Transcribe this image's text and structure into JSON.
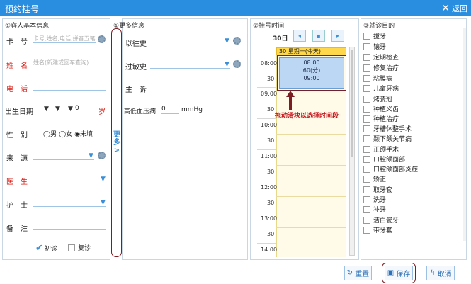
{
  "window": {
    "title": "预约挂号",
    "close_label": "返回"
  },
  "basic": {
    "title": "①客人基本信息",
    "card_label": "卡　号",
    "card_placeholder": "卡号,姓名,电话,拼音五笔",
    "name_label": "姓　名",
    "name_placeholder": "姓名(新建或回车查询)",
    "phone_label": "电　话",
    "birth_label": "出生日期",
    "birth_value": "0",
    "birth_unit": "岁",
    "gender_label": "性　别",
    "gender_options": [
      "男",
      "女",
      "未填"
    ],
    "gender_selected": "未填",
    "source_label": "来　源",
    "doctor_label": "医　生",
    "nurse_label": "护　士",
    "note_label": "备　注",
    "first_visit": "初诊",
    "revisit": "复诊"
  },
  "more": {
    "title": "①更多信息",
    "past_label": "以往史",
    "allergy_label": "过敏史",
    "complaint_label": "主　诉",
    "bp_label": "高低血压病",
    "bp_value": "0",
    "bp_unit": "mmHg",
    "toggle_label": "更多>"
  },
  "schedule": {
    "title": "②挂号时间",
    "day": "30日",
    "day_header": "30 星期一(今天)",
    "times": [
      "08:00",
      "30",
      "09:00",
      "30",
      "10:00",
      "30",
      "11:00",
      "30",
      "12:00",
      "30",
      "13:00",
      "30",
      "14:00"
    ],
    "slot_start": "08:00",
    "slot_duration": "60(分)",
    "slot_end": "09:00",
    "hint": "拖动滑块以选择时间段"
  },
  "purpose": {
    "title": "③就诊目的",
    "items": [
      "拔牙",
      "镶牙",
      "定期检查",
      "修复治疗",
      "粘膜病",
      "儿童牙病",
      "烤瓷冠",
      "种植义齿",
      "种植治疗",
      "牙槽休整手术",
      "颞下颌关节病",
      "正颌手术",
      "口腔颌面部",
      "口腔颌面部炎症",
      "矫正",
      "取牙套",
      "洗牙",
      "补牙",
      "洁白瓷牙",
      "带牙套"
    ]
  },
  "footer": {
    "reset": "重置",
    "save": "保存",
    "cancel": "取消"
  },
  "colors": {
    "titlebar": "#2a8ee0",
    "accent": "#3a8fd8",
    "required": "#d9241b"
  }
}
